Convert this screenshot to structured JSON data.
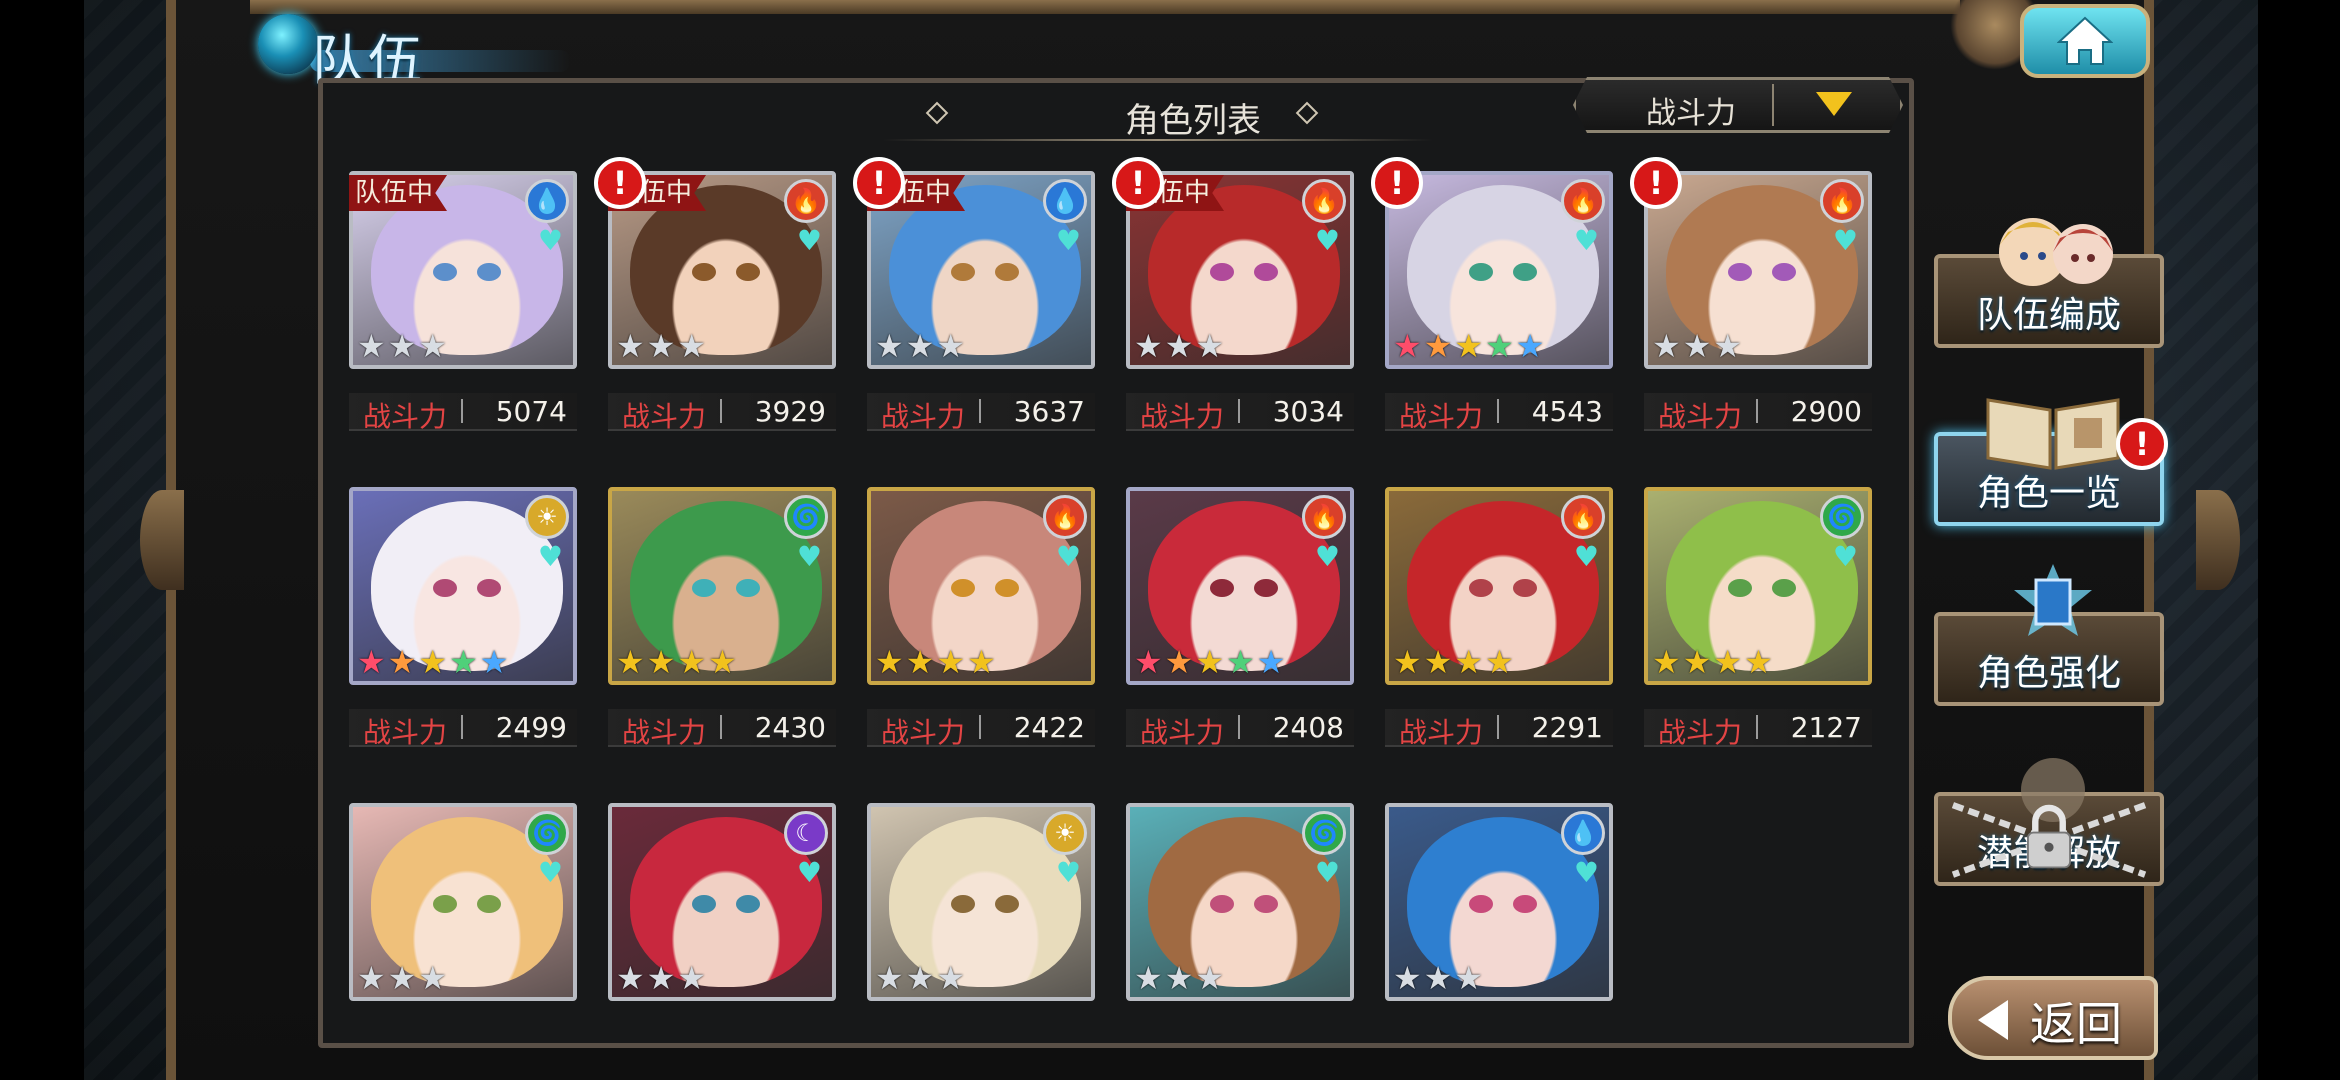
{
  "header": {
    "title": "队伍",
    "panel_title": "角色列表",
    "sort_label": "战斗力"
  },
  "power_label": "战斗力",
  "in_team_label": "队伍中",
  "alert_glyph": "!",
  "characters": [
    {
      "power": "5074",
      "element": "water",
      "element_glyph": "💧",
      "stars": 3,
      "rarity": "silver",
      "in_team": true,
      "alert": false,
      "hair": "#c8b6e8",
      "skin": "#f6e2da",
      "eye": "#5c8fcb",
      "bg": "#d9d2ee"
    },
    {
      "power": "3929",
      "element": "fire",
      "element_glyph": "🔥",
      "stars": 3,
      "rarity": "silver",
      "in_team": true,
      "alert": true,
      "hair": "#5a3a28",
      "skin": "#f2d2bb",
      "eye": "#8b5a2b",
      "bg": "#b89a86"
    },
    {
      "power": "3637",
      "element": "water",
      "element_glyph": "💧",
      "stars": 3,
      "rarity": "silver",
      "in_team": true,
      "alert": true,
      "hair": "#4b90d8",
      "skin": "#efd6c6",
      "eye": "#b07a3a",
      "bg": "#7fa5c8"
    },
    {
      "power": "3034",
      "element": "fire",
      "element_glyph": "🔥",
      "stars": 3,
      "rarity": "silver",
      "in_team": true,
      "alert": true,
      "hair": "#b82a2a",
      "skin": "#f4d8cc",
      "eye": "#b04a9a",
      "bg": "#8a3434"
    },
    {
      "power": "4543",
      "element": "fire",
      "element_glyph": "🔥",
      "stars": 5,
      "rarity": "purple",
      "in_team": false,
      "alert": true,
      "hair": "#d7d4e4",
      "skin": "#f7e4dc",
      "eye": "#3fa086",
      "bg": "#c6b9df"
    },
    {
      "power": "2900",
      "element": "fire",
      "element_glyph": "🔥",
      "stars": 3,
      "rarity": "silver",
      "in_team": false,
      "alert": true,
      "hair": "#b07a52",
      "skin": "#f6e0d2",
      "eye": "#a25ab8",
      "bg": "#c9a890"
    },
    {
      "power": "2499",
      "element": "light",
      "element_glyph": "☀",
      "stars": 5,
      "rarity": "purple",
      "in_team": false,
      "alert": false,
      "hair": "#f1eef6",
      "skin": "#f8e6e2",
      "eye": "#b04a74",
      "bg": "#6a6fb8"
    },
    {
      "power": "2430",
      "element": "wind",
      "element_glyph": "🌀",
      "stars": 4,
      "rarity": "gold",
      "in_team": false,
      "alert": false,
      "hair": "#3d9a4c",
      "skin": "#d9b08e",
      "eye": "#3fb0b8",
      "bg": "#9a8a5a"
    },
    {
      "power": "2422",
      "element": "fire",
      "element_glyph": "🔥",
      "stars": 4,
      "rarity": "gold",
      "in_team": false,
      "alert": false,
      "hair": "#c8877a",
      "skin": "#f3d6c8",
      "eye": "#d0902a",
      "bg": "#7c5a48"
    },
    {
      "power": "2408",
      "element": "fire",
      "element_glyph": "🔥",
      "stars": 5,
      "rarity": "purple",
      "in_team": false,
      "alert": false,
      "hair": "#c92a3a",
      "skin": "#f3dad4",
      "eye": "#8e2a3a",
      "bg": "#5a3a48"
    },
    {
      "power": "2291",
      "element": "fire",
      "element_glyph": "🔥",
      "stars": 4,
      "rarity": "gold",
      "in_team": false,
      "alert": false,
      "hair": "#c5262a",
      "skin": "#f3d3c6",
      "eye": "#b0424a",
      "bg": "#8a6a3a"
    },
    {
      "power": "2127",
      "element": "wind",
      "element_glyph": "🌀",
      "stars": 4,
      "rarity": "gold",
      "in_team": false,
      "alert": false,
      "hair": "#8fbf4a",
      "skin": "#f5dcc8",
      "eye": "#5aa04a",
      "bg": "#aab070"
    },
    {
      "power": "",
      "element": "wind",
      "element_glyph": "🌀",
      "stars": 3,
      "rarity": "silver",
      "in_team": false,
      "alert": false,
      "hair": "#efc07a",
      "skin": "#f8e2d2",
      "eye": "#7aa04a",
      "bg": "#e6b8b4"
    },
    {
      "power": "",
      "element": "dark",
      "element_glyph": "☾",
      "stars": 3,
      "rarity": "silver",
      "in_team": false,
      "alert": false,
      "hair": "#c8283e",
      "skin": "#f1d0c4",
      "eye": "#3f8aa8",
      "bg": "#6a2a3a"
    },
    {
      "power": "",
      "element": "light",
      "element_glyph": "☀",
      "stars": 3,
      "rarity": "silver",
      "in_team": false,
      "alert": false,
      "hair": "#e8dcbc",
      "skin": "#f5e4d6",
      "eye": "#8a6a3a",
      "bg": "#d0c4b0"
    },
    {
      "power": "",
      "element": "wind",
      "element_glyph": "🌀",
      "stars": 3,
      "rarity": "silver",
      "in_team": false,
      "alert": false,
      "hair": "#a06a42",
      "skin": "#f5d8c8",
      "eye": "#c0507a",
      "bg": "#5ab0b8"
    },
    {
      "power": "",
      "element": "water",
      "element_glyph": "💧",
      "stars": 3,
      "rarity": "silver",
      "in_team": false,
      "alert": false,
      "hair": "#2e7fd0",
      "skin": "#f3d8d2",
      "eye": "#c84a7a",
      "bg": "#3a5a8a"
    }
  ],
  "sidebar": {
    "team_edit": "队伍编成",
    "char_list": "角色一览",
    "char_enhance": "角色强化",
    "potential": "潜能解放",
    "char_list_alert": true
  },
  "back_label": "返回",
  "colors": {
    "accent": "#8fd5ee",
    "alert": "#d71818",
    "power_label": "#e34444",
    "star_gold": "#f2c21d",
    "star_silver": "#d8dde3",
    "star_rainbow": [
      "#ff4d6a",
      "#ff9a3d",
      "#f2c21d",
      "#4fd07a",
      "#4aa8ff"
    ],
    "element": {
      "water": "#2a78d6",
      "fire": "#d9402a",
      "wind": "#2fa84a",
      "light": "#d8a92a",
      "dark": "#7a3ac8"
    }
  }
}
